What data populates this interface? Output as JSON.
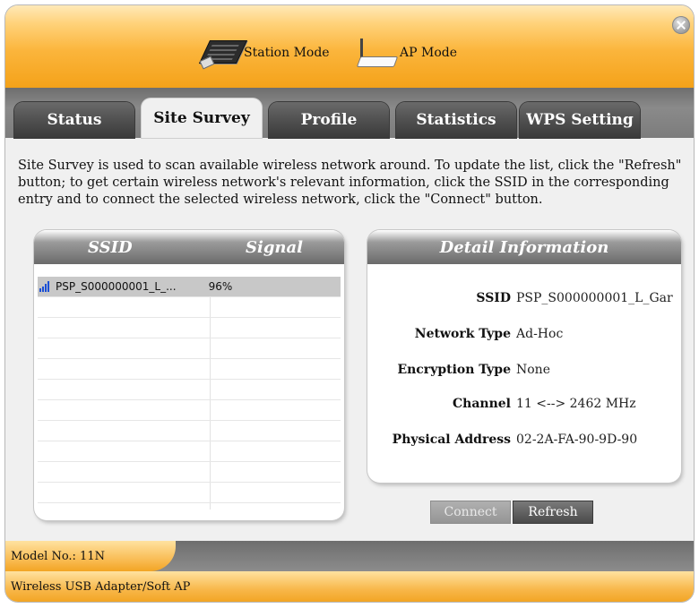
{
  "header": {
    "modes": [
      {
        "label": "Station Mode",
        "icon": "station-adapter-icon"
      },
      {
        "label": "AP Mode",
        "icon": "access-point-icon"
      }
    ]
  },
  "tabs": [
    "Status",
    "Site Survey",
    "Profile",
    "Statistics",
    "WPS Setting"
  ],
  "active_tab": "Site Survey",
  "description": "Site Survey is used to scan available wireless network around. To update the list, click the \"Refresh\" button; to get certain wireless network's relevant information, click the SSID in the corresponding entry and to connect the selected wireless network, click the \"Connect\" button.",
  "network_list": {
    "columns": [
      "SSID",
      "Signal"
    ],
    "rows": [
      {
        "ssid": "PSP_S000000001_L_...",
        "signal": "96%",
        "icon": "signal-strength-icon",
        "selected": true
      }
    ],
    "empty_rows": 11
  },
  "detail": {
    "title": "Detail Information",
    "fields": [
      {
        "label": "SSID",
        "value": "PSP_S000000001_L_Gar"
      },
      {
        "label": "Network Type",
        "value": "Ad-Hoc"
      },
      {
        "label": "Encryption Type",
        "value": "None"
      },
      {
        "label": "Channel",
        "value": "11 <--> 2462 MHz"
      },
      {
        "label": "Physical Address",
        "value": "02-2A-FA-90-9D-90"
      }
    ]
  },
  "buttons": {
    "connect": "Connect",
    "refresh": "Refresh"
  },
  "footer": {
    "model": "Model No.: 11N",
    "product": "Wireless USB Adapter/Soft AP"
  },
  "colors": {
    "accent": "#f8b74a",
    "tab_dark": "#4e4e4e",
    "selection": "#c8c8c8",
    "signal": "#1a4fd6"
  }
}
